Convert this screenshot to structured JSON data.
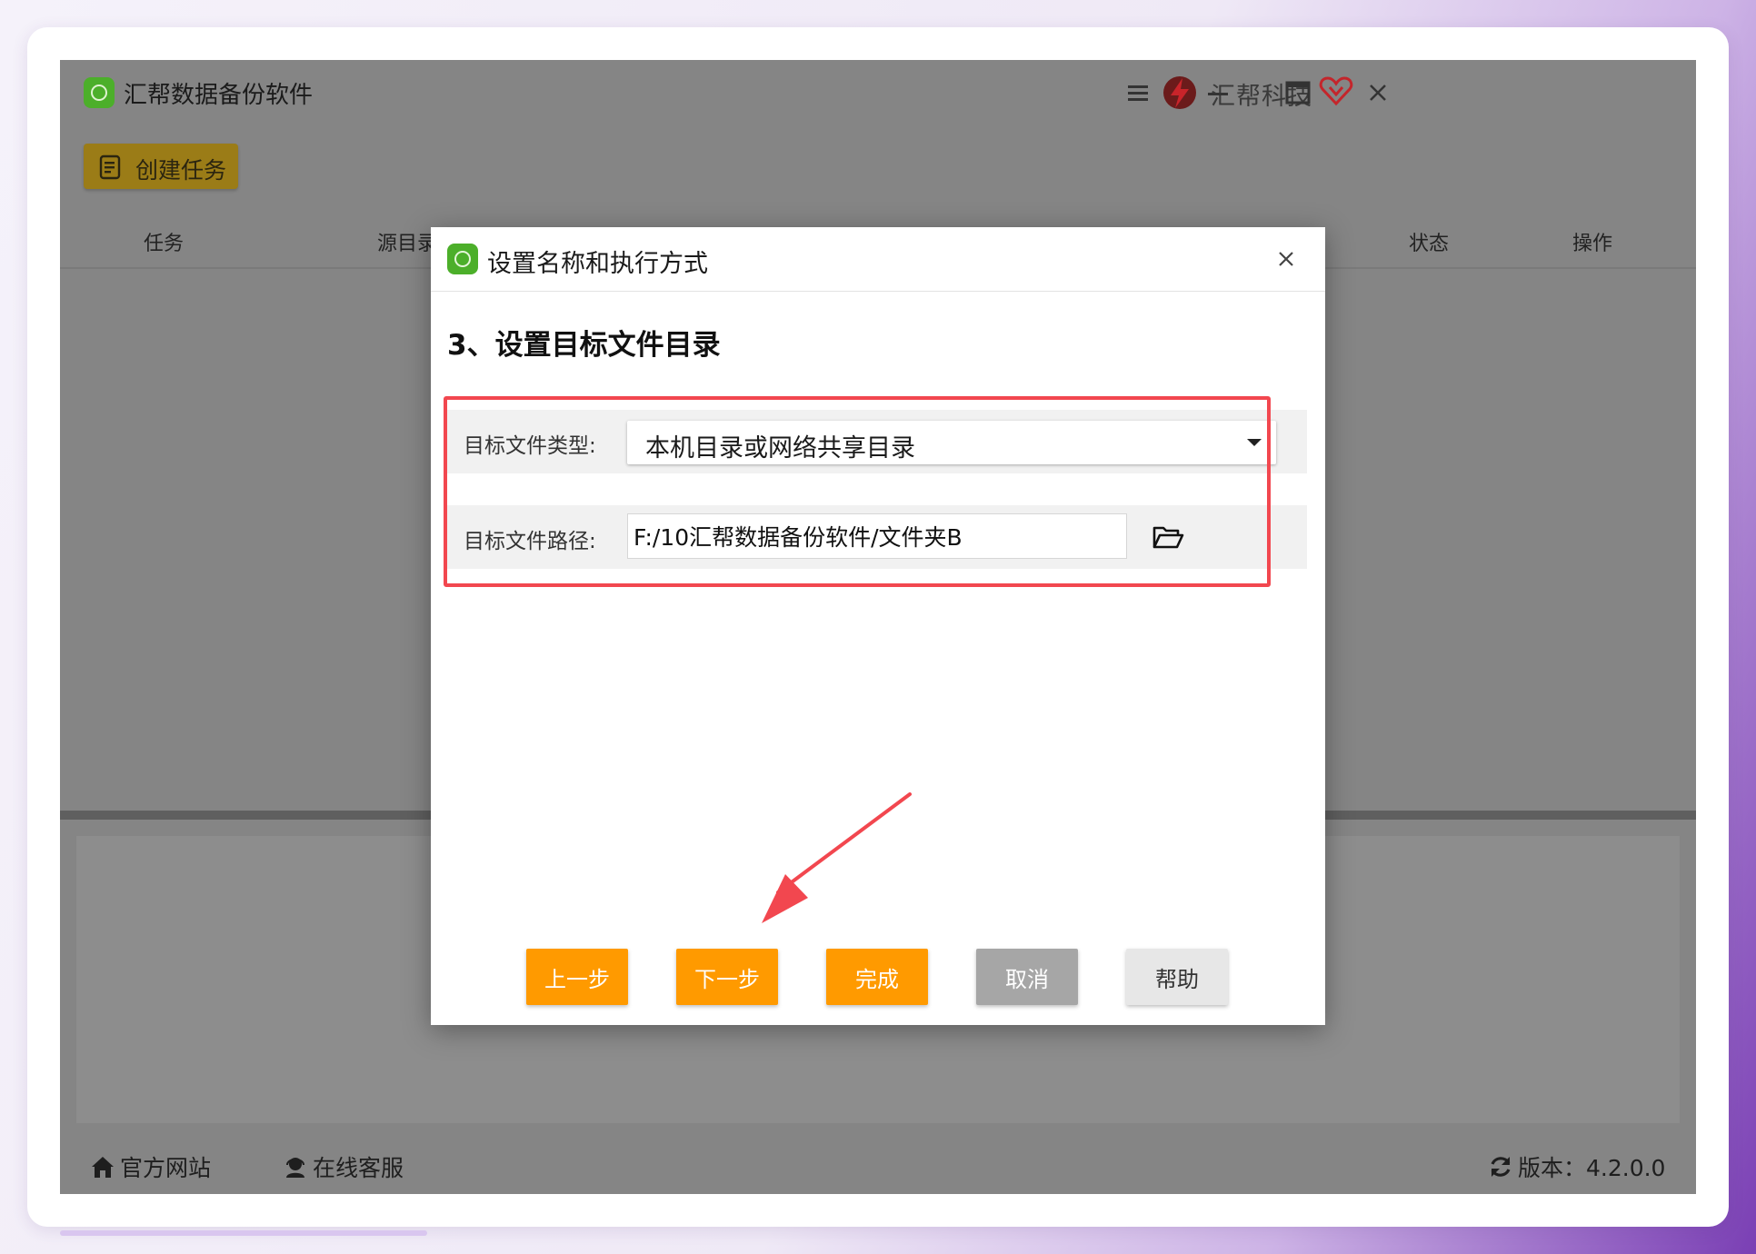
{
  "app": {
    "title": "汇帮数据备份软件",
    "brand_name": "汇帮科技",
    "toolbar": {
      "create_task_label": "创建任务"
    },
    "table_columns": [
      "任务",
      "源目录",
      "状态",
      "操作"
    ],
    "statusbar": {
      "official_site": "官方网站",
      "online_support": "在线客服",
      "version": "版本：4.2.0.0"
    }
  },
  "dialog": {
    "title": "设置名称和执行方式",
    "step_title": "3、设置目标文件目录",
    "target_type": {
      "label": "目标文件类型:",
      "selected": "本机目录或网络共享目录"
    },
    "target_path": {
      "label": "目标文件路径:",
      "value": "F:/10汇帮数据备份软件/文件夹B"
    },
    "buttons": {
      "prev": "上一步",
      "next": "下一步",
      "finish": "完成",
      "cancel": "取消",
      "help": "帮助"
    }
  },
  "colors": {
    "accent_orange": "#ff9a00",
    "highlight_red": "#f2474f",
    "logo_green": "#4caf2a",
    "toolbar_gold": "#9b7c17"
  },
  "icons": {
    "app_logo": "app-logo-icon",
    "brand_logo": "brand-bolt-icon",
    "brand_vip": "heart-vip-icon",
    "menu": "hamburger-menu-icon",
    "minimize": "minimize-icon",
    "maximize": "maximize-icon",
    "close": "close-icon",
    "create_task": "task-list-icon",
    "folder": "folder-open-icon",
    "home": "home-icon",
    "support": "headset-icon",
    "refresh": "refresh-icon"
  }
}
